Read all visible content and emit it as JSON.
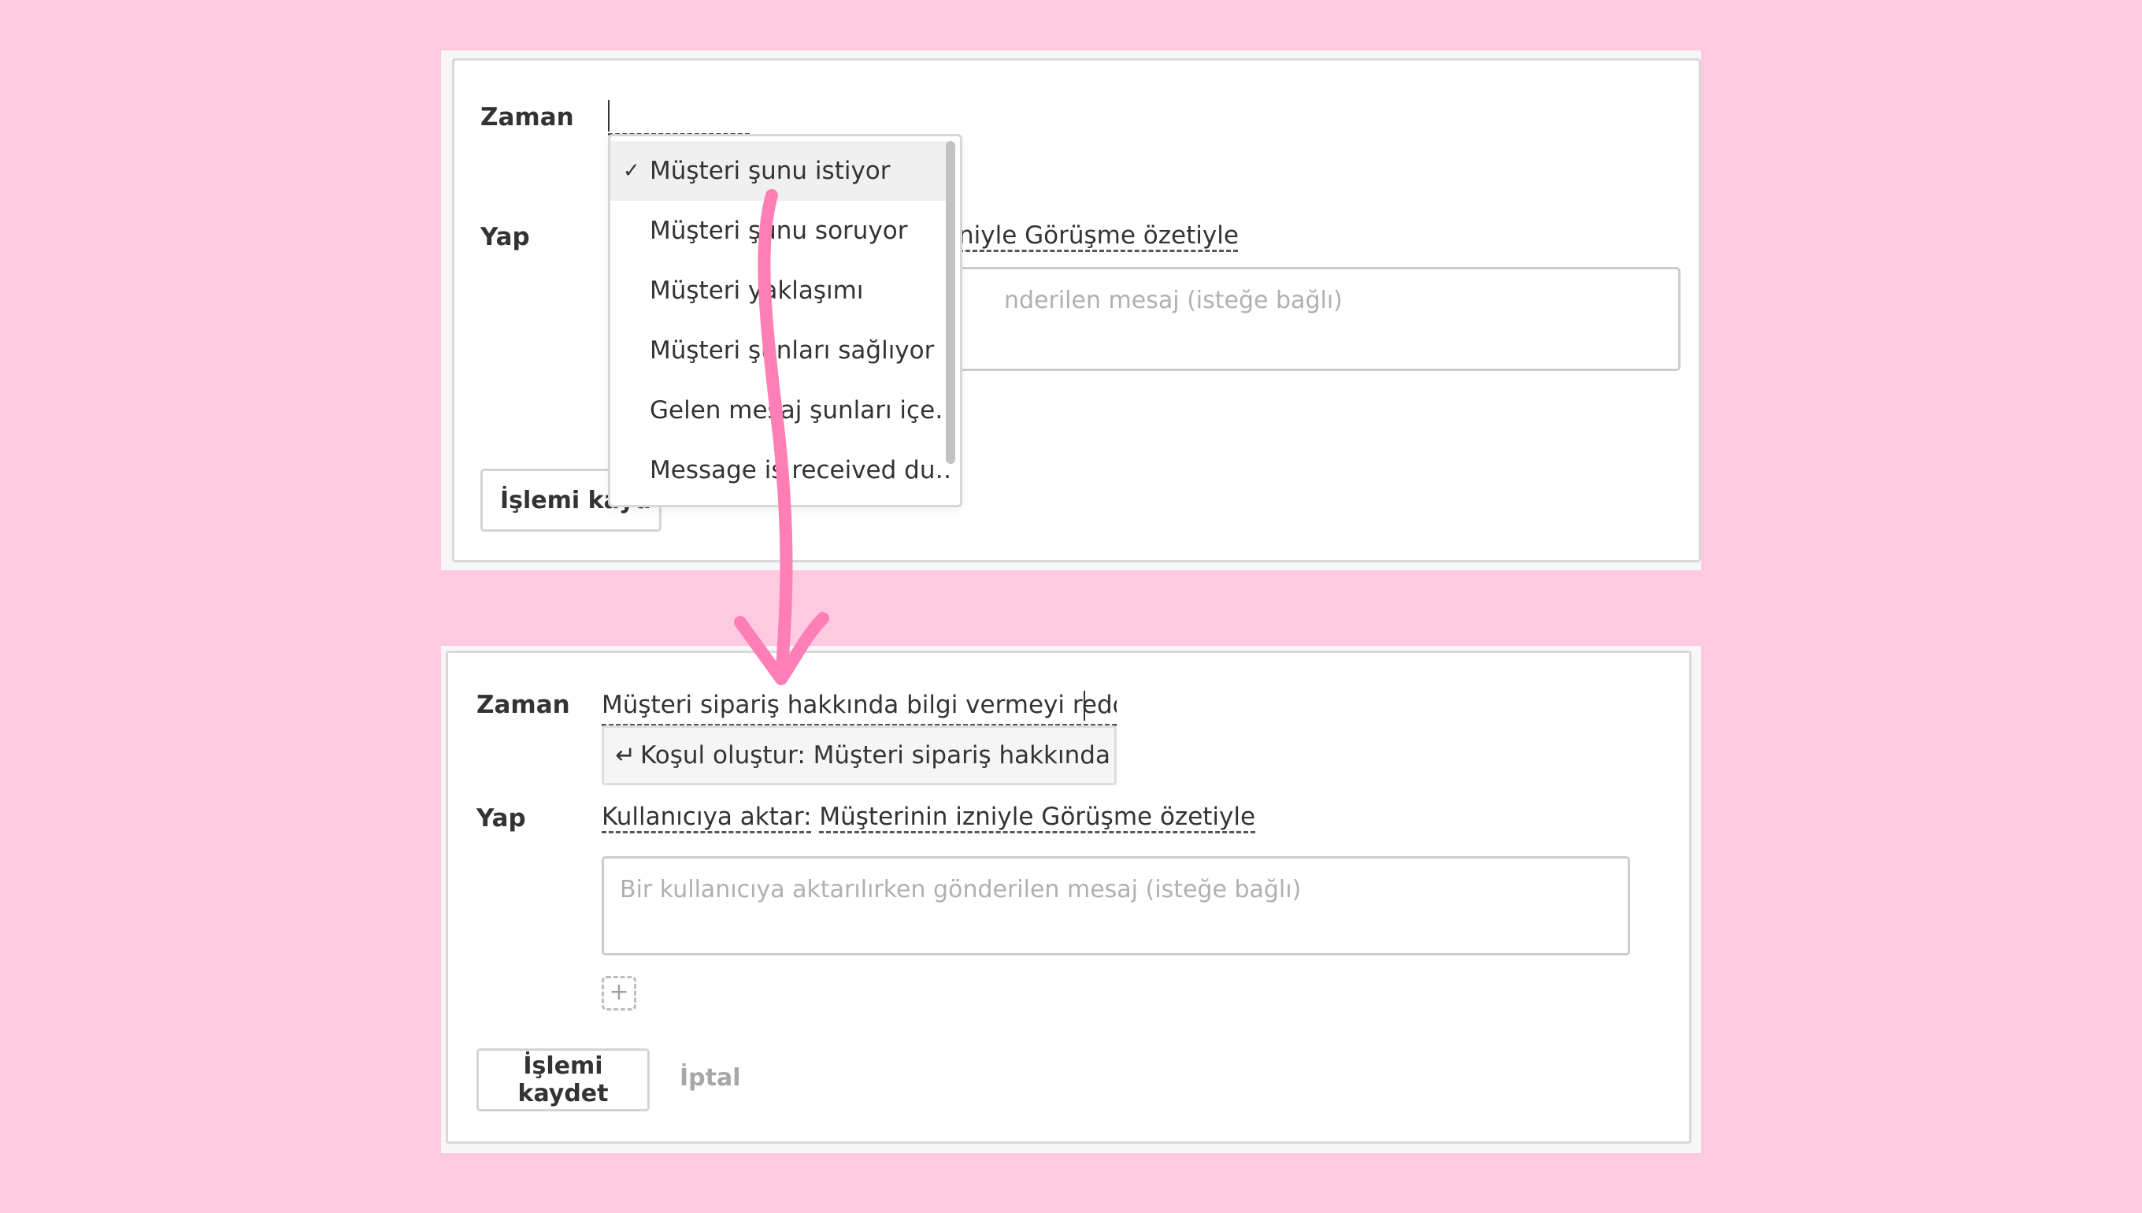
{
  "colors": {
    "background": "#ffc9e0",
    "arrow": "#ff7eb6",
    "text": "#333333",
    "placeholder": "#b0b0b0",
    "muted_link": "#a7a7a7"
  },
  "top": {
    "when_label": "Zaman",
    "do_label": "Yap",
    "do_value_visible": "niyle Görüşme özetiyle",
    "message_placeholder_visible": "nderilen mesaj (isteğe bağlı)",
    "save_button_visible": "İşlemi kayd",
    "dropdown": {
      "items": [
        {
          "label": "Müşteri şunu istiyor",
          "selected": true
        },
        {
          "label": "Müşteri şunu soruyor",
          "selected": false
        },
        {
          "label": "Müşteri yaklaşımı",
          "selected": false
        },
        {
          "label": "Müşteri şunları sağlıyor",
          "selected": false
        },
        {
          "label": "Gelen mesaj şunları içe…",
          "selected": false
        },
        {
          "label": "Message is received du…",
          "selected": false
        }
      ],
      "check_icon": "✓"
    }
  },
  "bottom": {
    "when_label": "Zaman",
    "when_value": "Müşteri sipariş hakkında bilgi vermeyi reddediy",
    "suggestion_icon": "↵",
    "suggestion": "Koşul oluştur: Müşteri sipariş hakkında ...",
    "do_label": "Yap",
    "do_prefix": "Kullanıcıya aktar:",
    "do_value": "Müşterinin izniyle Görüşme özetiyle",
    "message_placeholder": "Bir kullanıcıya aktarılırken gönderilen mesaj (isteğe bağlı)",
    "add_icon": "+",
    "save_button": "İşlemi kaydet",
    "cancel_link": "İptal"
  }
}
